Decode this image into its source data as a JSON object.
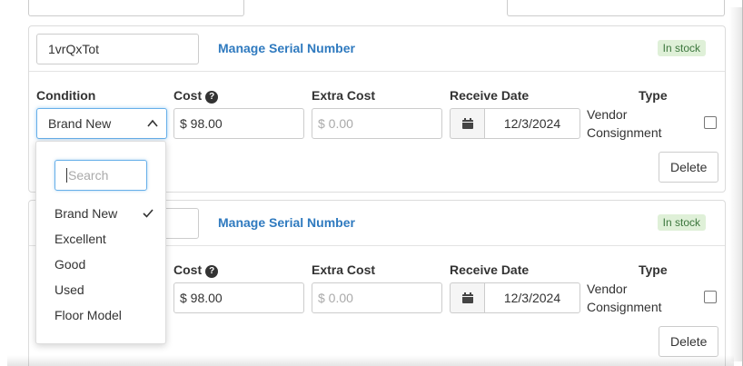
{
  "card1": {
    "serial_value": "1vrQxTot",
    "manage_link": "Manage Serial Number",
    "stock_badge": "In stock",
    "labels": {
      "condition": "Condition",
      "cost": "Cost",
      "extra_cost": "Extra Cost",
      "receive_date": "Receive Date",
      "type": "Type"
    },
    "condition_value": "Brand New",
    "cost_value": "$ 98.00",
    "extra_cost_placeholder": "$ 0.00",
    "receive_date_value": "12/3/2024",
    "type_line1": "Vendor",
    "type_line2": "Consignment",
    "delete_label": "Delete"
  },
  "card2": {
    "manage_link": "Manage Serial Number",
    "stock_badge": "In stock",
    "labels": {
      "cost": "Cost",
      "extra_cost": "Extra Cost",
      "receive_date": "Receive Date",
      "type": "Type"
    },
    "cost_value": "$ 98.00",
    "extra_cost_placeholder": "$ 0.00",
    "receive_date_value": "12/3/2024",
    "type_line1": "Vendor",
    "type_line2": "Consignment",
    "delete_label": "Delete"
  },
  "help_glyph": "?",
  "condition_dropdown": {
    "search_placeholder": "Search",
    "options": [
      "Brand New",
      "Excellent",
      "Good",
      "Used",
      "Floor Model"
    ],
    "selected": "Brand New"
  },
  "colors": {
    "link": "#2f7abf",
    "badge_bg": "#dff0d8",
    "badge_text": "#3c763d",
    "focus": "#66afe9"
  }
}
